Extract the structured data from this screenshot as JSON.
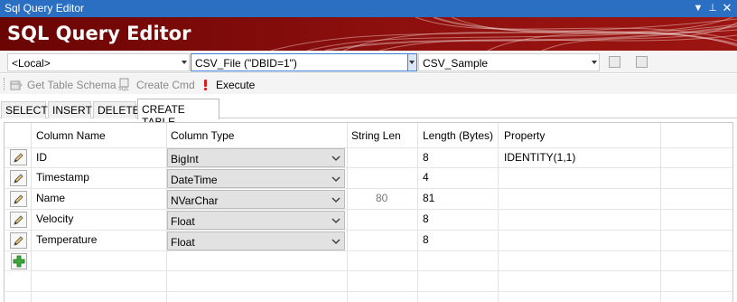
{
  "window": {
    "title": "Sql Query Editor"
  },
  "banner": {
    "title": "SQL Query Editor"
  },
  "selectors": {
    "server": "<Local>",
    "database": "CSV_File (\"DBID=1\")",
    "table": "CSV_Sample"
  },
  "toolbar": {
    "get_schema": "Get Table Schema",
    "create_cmd": "Create Cmd",
    "execute": "Execute"
  },
  "tabs": [
    "SELECT",
    "INSERT",
    "DELETE",
    "CREATE TABLE"
  ],
  "grid": {
    "headers": {
      "column_name": "Column Name",
      "column_type": "Column Type",
      "string_len": "String Len",
      "length_bytes": "Length (Bytes)",
      "property": "Property"
    },
    "rows": [
      {
        "name": "ID",
        "type": "BigInt",
        "string_len": "",
        "length": "8",
        "property": "IDENTITY(1,1)"
      },
      {
        "name": "Timestamp",
        "type": "DateTime",
        "string_len": "",
        "length": "4",
        "property": ""
      },
      {
        "name": "Name",
        "type": "NVarChar",
        "string_len": "80",
        "length": "81",
        "property": ""
      },
      {
        "name": "Velocity",
        "type": "Float",
        "string_len": "",
        "length": "8",
        "property": ""
      },
      {
        "name": "Temperature",
        "type": "Float",
        "string_len": "",
        "length": "8",
        "property": ""
      }
    ]
  },
  "colors": {
    "titlebar": "#2b6fc2",
    "banner": "#7c0a08",
    "execute_icon": "#d81e1e",
    "add_icon": "#3aa83a"
  },
  "icons": {
    "edit": "pencil-icon",
    "add": "plus-icon",
    "get_schema": "table-schema-icon",
    "create_cmd": "sql-icon",
    "execute": "exclamation-icon"
  }
}
